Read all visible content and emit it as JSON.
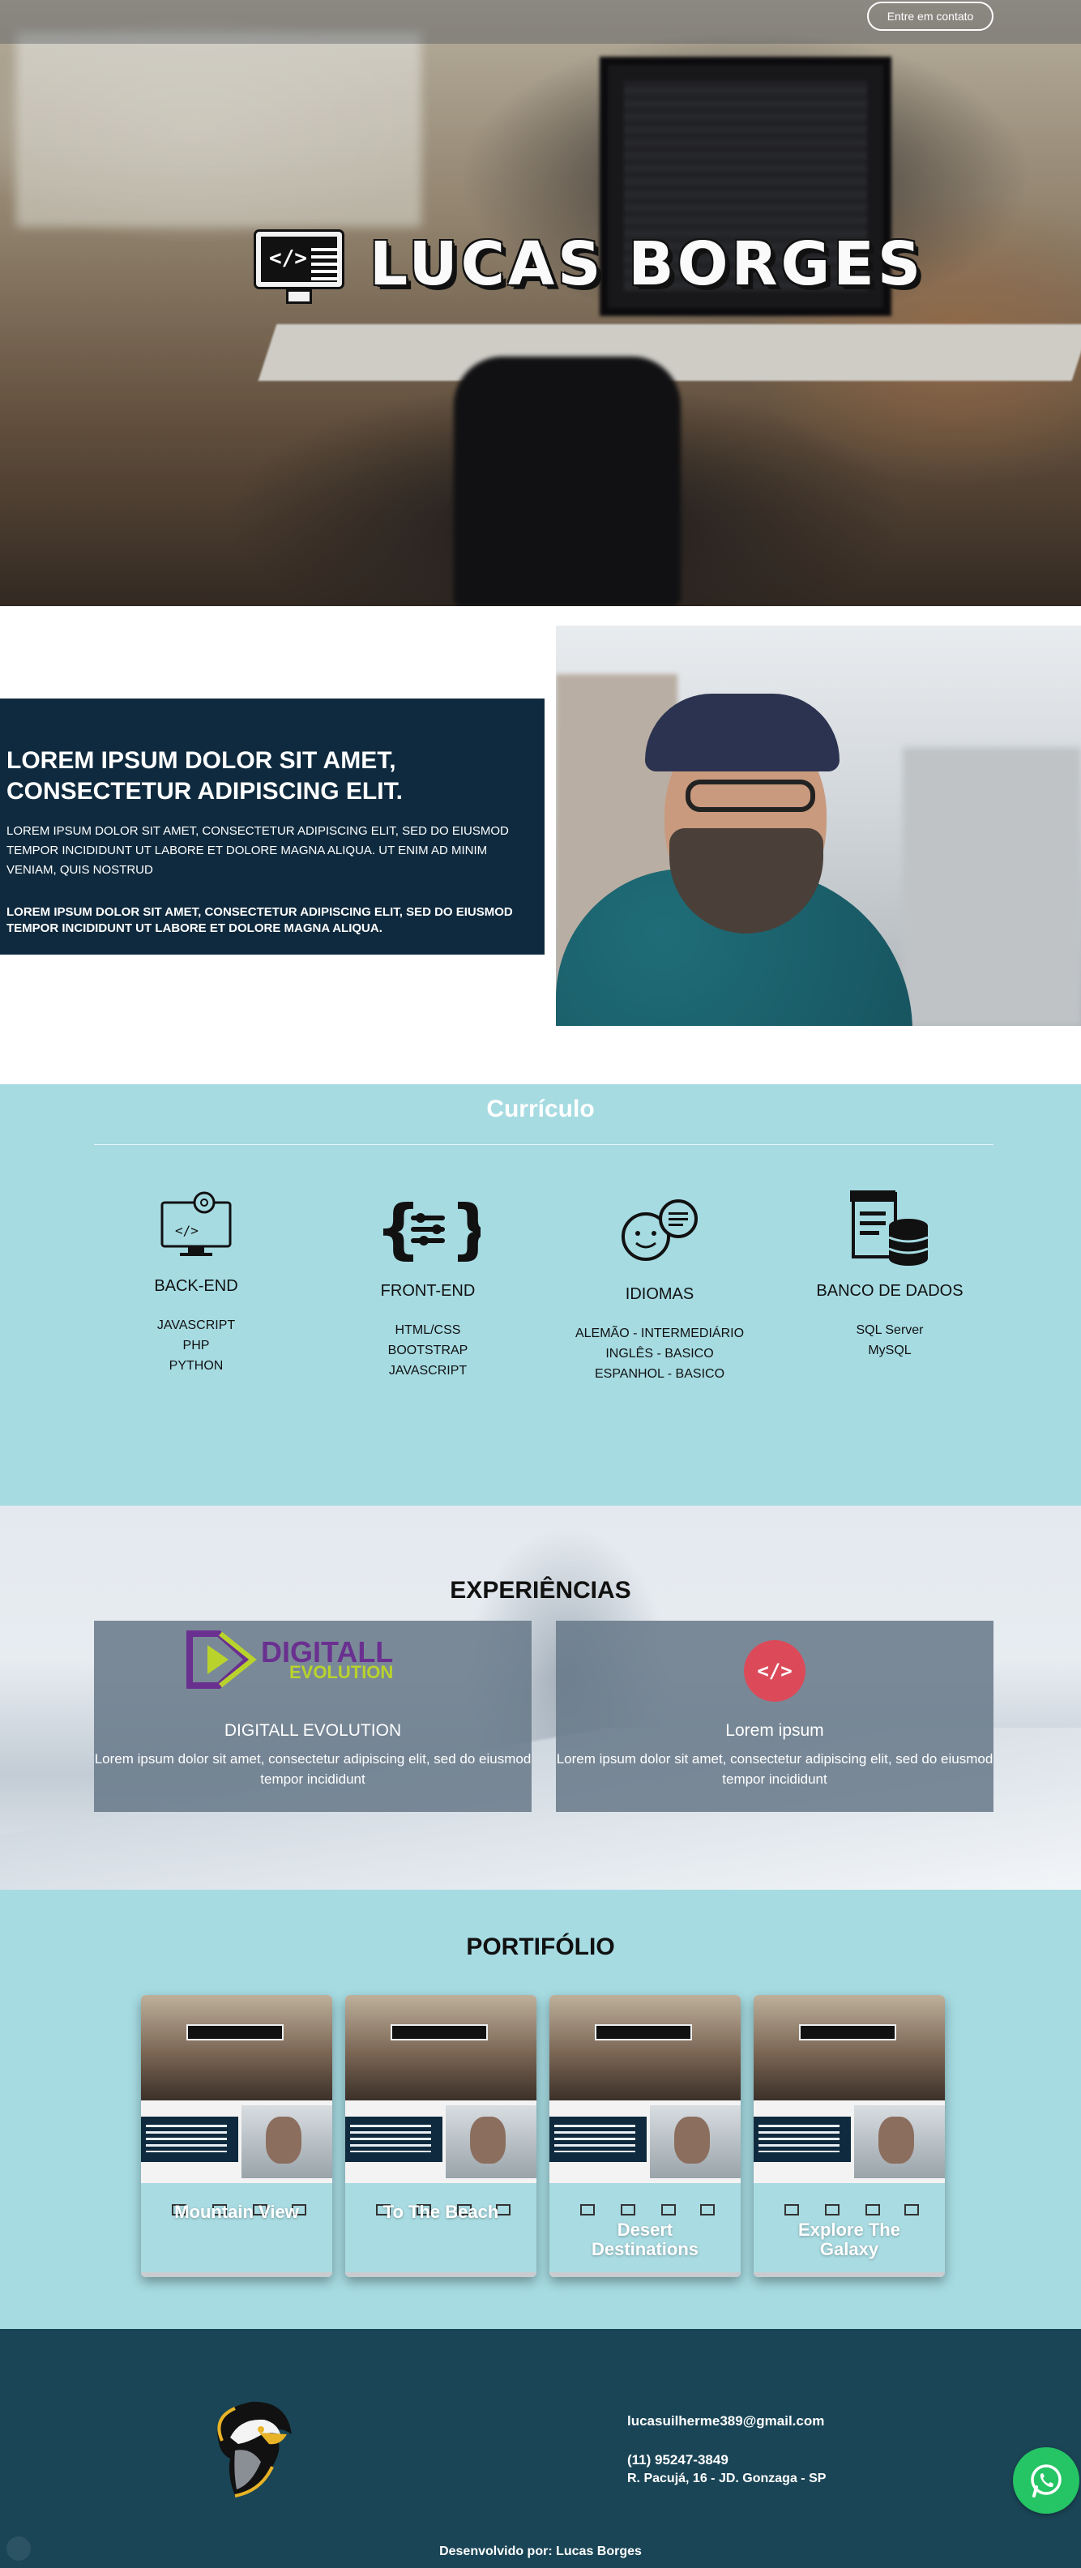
{
  "header": {
    "contact_button": "Entre em contato"
  },
  "hero": {
    "logo_text": "LUCAS BORGES",
    "logo_code": "</>"
  },
  "about": {
    "title": "LOREM IPSUM DOLOR SIT AMET, CONSECTETUR ADIPISCING ELIT.",
    "paragraph1": "LOREM IPSUM DOLOR SIT AMET, CONSECTETUR ADIPISCING ELIT, SED DO EIUSMOD TEMPOR INCIDIDUNT UT LABORE ET DOLORE MAGNA ALIQUA. UT ENIM AD MINIM VENIAM, QUIS NOSTRUD",
    "paragraph2": "LOREM IPSUM DOLOR SIT AMET, CONSECTETUR ADIPISCING ELIT, SED DO EIUSMOD TEMPOR INCIDIDUNT UT LABORE ET DOLORE MAGNA ALIQUA."
  },
  "curriculo": {
    "title": "Currículo",
    "skills": [
      {
        "title": "BACK-END",
        "icon": "computer-gear-icon",
        "items": [
          "JAVASCRIPT",
          "PHP",
          "PYTHON"
        ]
      },
      {
        "title": "FRONT-END",
        "icon": "code-braces-icon",
        "items": [
          "HTML/CSS",
          "BOOTSTRAP",
          "JAVASCRIPT"
        ]
      },
      {
        "title": "IDIOMAS",
        "icon": "speech-bubbles-icon",
        "items": [
          "ALEMÃO - INTERMEDIÁRIO",
          "INGLÊS - BASICO",
          "ESPANHOL - BASICO"
        ]
      },
      {
        "title": "BANCO DE DADOS",
        "icon": "database-icon",
        "items": [
          "SQL Server",
          "MySQL"
        ]
      }
    ]
  },
  "experiencias": {
    "title": "EXPERIÊNCIAS",
    "cards": [
      {
        "logo_text1": "DIGITALL",
        "logo_text2": "EVOLUTION",
        "title": "DIGITALL EVOLUTION",
        "text": "Lorem ipsum dolor sit amet, consectetur adipiscing elit, sed do eiusmod tempor incididunt"
      },
      {
        "logo_text": "</>",
        "title": "Lorem ipsum",
        "text": "Lorem ipsum dolor sit amet, consectetur adipiscing elit, sed do eiusmod tempor incididunt"
      }
    ]
  },
  "portfolio": {
    "title": "PORTIFÓLIO",
    "items": [
      {
        "label": "Mountain View"
      },
      {
        "label": "To The Beach"
      },
      {
        "label": "Desert Destinations"
      },
      {
        "label": "Explore The Galaxy"
      }
    ]
  },
  "footer": {
    "email": "lucasuilherme389@gmail.com",
    "phone": "(11) 95247-3849",
    "address": "R. Pacujá, 16 - JD. Gonzaga - SP",
    "developed_by": "Desenvolvido por: Lucas Borges"
  },
  "colors": {
    "navy": "#0f2a3e",
    "light_blue": "#a6dbe2",
    "footer": "#1a4556",
    "whatsapp": "#25c464",
    "accent_red": "#dc4a5a",
    "digitall_purple": "#6a3090",
    "digitall_green": "#b9d32c"
  }
}
